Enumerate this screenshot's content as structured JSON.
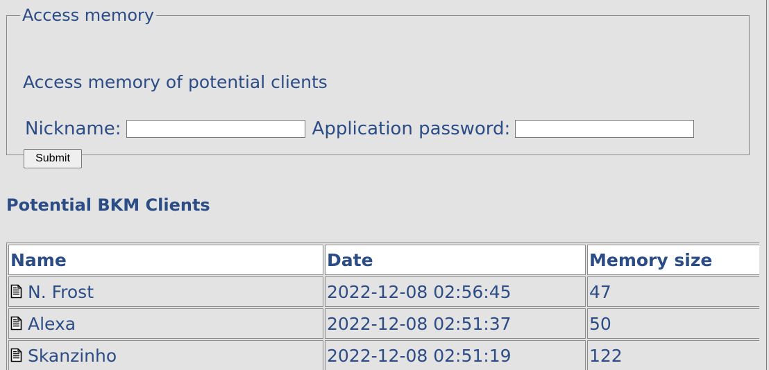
{
  "access": {
    "legend": "Access memory",
    "description": "Access memory of potential clients",
    "nickname_label": "Nickname:",
    "nickname_value": "",
    "password_label": "Application password:",
    "password_value": "",
    "submit_label": "Submit"
  },
  "clients": {
    "heading": "Potential BKM Clients",
    "columns": [
      "Name",
      "Date",
      "Memory size"
    ],
    "row_icon": "document-icon",
    "rows": [
      {
        "name": "N. Frost",
        "date": "2022-12-08 02:56:45",
        "size": "47"
      },
      {
        "name": "Alexa",
        "date": "2022-12-08 02:51:37",
        "size": "50"
      },
      {
        "name": "Skanzinho",
        "date": "2022-12-08 02:51:19",
        "size": "122"
      }
    ]
  },
  "colors": {
    "text": "#2c4c86",
    "background": "#e3e3e3",
    "header_bg": "#ffffff",
    "border": "#8a8a8a"
  }
}
